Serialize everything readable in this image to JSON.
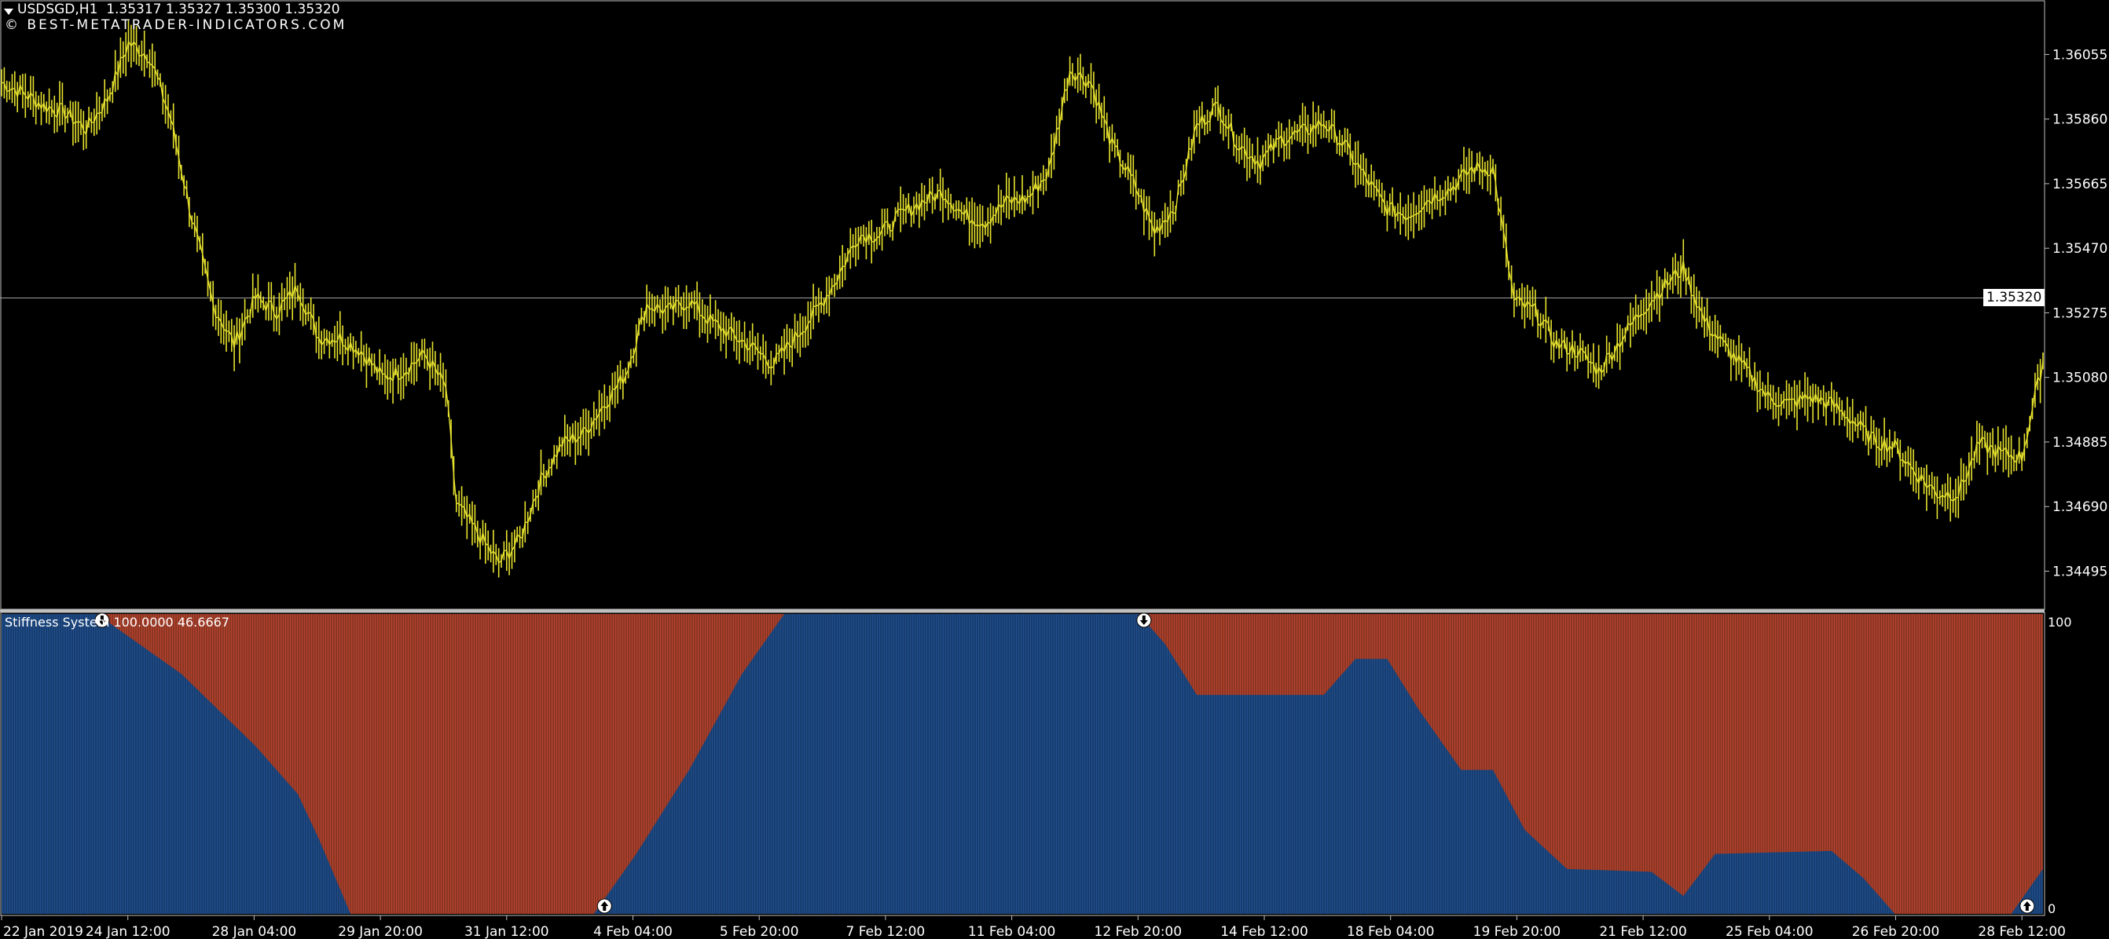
{
  "window": {
    "symbol_line": "USDSGD,H1  1.35317 1.35327 1.35300 1.35320",
    "watermark": "© BEST-METATRADER-INDICATORS.COM"
  },
  "colors": {
    "background": "#000000",
    "price_line": "#e6e22e",
    "grid_line": "#c0c0c0",
    "indicator_blue": "#1f4f8f",
    "indicator_red": "#b5452e",
    "text": "#ffffff"
  },
  "price_axis": {
    "labels": [
      "1.36055",
      "1.35860",
      "1.35665",
      "1.35470",
      "1.35275",
      "1.35080",
      "1.34885",
      "1.34690",
      "1.34495"
    ],
    "current_price": "1.35320"
  },
  "indicator": {
    "label": "Stiffness System 100.0000 46.6667",
    "axis_top": "100",
    "axis_bottom": "0"
  },
  "time_axis": {
    "labels": [
      "22 Jan 2019",
      "24 Jan 12:00",
      "28 Jan 04:00",
      "29 Jan 20:00",
      "31 Jan 12:00",
      "4 Feb 04:00",
      "5 Feb 20:00",
      "7 Feb 12:00",
      "11 Feb 04:00",
      "12 Feb 20:00",
      "14 Feb 12:00",
      "18 Feb 04:00",
      "19 Feb 20:00",
      "21 Feb 12:00",
      "25 Feb 04:00",
      "26 Feb 20:00",
      "28 Feb 12:00"
    ]
  },
  "chart_data": [
    {
      "type": "line",
      "title": "USDSGD,H1",
      "ylim": [
        1.3438,
        1.3621
      ],
      "x_labels": [
        "22 Jan 2019",
        "24 Jan 12:00",
        "28 Jan 04:00",
        "29 Jan 20:00",
        "31 Jan 12:00",
        "4 Feb 04:00",
        "5 Feb 20:00",
        "7 Feb 12:00",
        "11 Feb 04:00",
        "12 Feb 20:00",
        "14 Feb 12:00",
        "18 Feb 04:00",
        "19 Feb 20:00",
        "21 Feb 12:00",
        "25 Feb 04:00",
        "26 Feb 20:00",
        "28 Feb 12:00"
      ],
      "series": [
        {
          "name": "USDSGD",
          "values": [
            [
              0,
              1.3597
            ],
            [
              4,
              1.3594
            ],
            [
              8,
              1.359
            ],
            [
              12,
              1.3588
            ],
            [
              16,
              1.3583
            ],
            [
              20,
              1.3592
            ],
            [
              24,
              1.3609
            ],
            [
              28,
              1.3605
            ],
            [
              32,
              1.3586
            ],
            [
              36,
              1.3556
            ],
            [
              40,
              1.353
            ],
            [
              44,
              1.3518
            ],
            [
              48,
              1.3532
            ],
            [
              52,
              1.3528
            ],
            [
              56,
              1.3535
            ],
            [
              60,
              1.352
            ],
            [
              64,
              1.352
            ],
            [
              68,
              1.3516
            ],
            [
              72,
              1.3508
            ],
            [
              76,
              1.351
            ],
            [
              80,
              1.3515
            ],
            [
              84,
              1.3505
            ],
            [
              86,
              1.347
            ],
            [
              90,
              1.3461
            ],
            [
              94,
              1.3452
            ],
            [
              98,
              1.3459
            ],
            [
              102,
              1.3477
            ],
            [
              106,
              1.3488
            ],
            [
              110,
              1.3491
            ],
            [
              114,
              1.35
            ],
            [
              118,
              1.3509
            ],
            [
              122,
              1.353
            ],
            [
              126,
              1.3528
            ],
            [
              130,
              1.3531
            ],
            [
              134,
              1.3525
            ],
            [
              138,
              1.3521
            ],
            [
              142,
              1.3517
            ],
            [
              146,
              1.3512
            ],
            [
              150,
              1.352
            ],
            [
              154,
              1.3528
            ],
            [
              158,
              1.3538
            ],
            [
              162,
              1.3551
            ],
            [
              166,
              1.3551
            ],
            [
              170,
              1.3557
            ],
            [
              174,
              1.3561
            ],
            [
              178,
              1.3564
            ],
            [
              182,
              1.3557
            ],
            [
              186,
              1.3555
            ],
            [
              190,
              1.3561
            ],
            [
              194,
              1.3562
            ],
            [
              198,
              1.357
            ],
            [
              202,
              1.3601
            ],
            [
              206,
              1.3597
            ],
            [
              210,
              1.3578
            ],
            [
              214,
              1.3567
            ],
            [
              218,
              1.3552
            ],
            [
              222,
              1.356
            ],
            [
              226,
              1.3584
            ],
            [
              230,
              1.359
            ],
            [
              234,
              1.3578
            ],
            [
              238,
              1.3573
            ],
            [
              242,
              1.358
            ],
            [
              246,
              1.3582
            ],
            [
              250,
              1.3585
            ],
            [
              254,
              1.3578
            ],
            [
              258,
              1.3568
            ],
            [
              262,
              1.3559
            ],
            [
              266,
              1.3557
            ],
            [
              270,
              1.3562
            ],
            [
              274,
              1.3565
            ],
            [
              278,
              1.3571
            ],
            [
              282,
              1.3571
            ],
            [
              286,
              1.3531
            ],
            [
              290,
              1.3528
            ],
            [
              294,
              1.3518
            ],
            [
              298,
              1.3516
            ],
            [
              302,
              1.351
            ],
            [
              306,
              1.3519
            ],
            [
              310,
              1.3528
            ],
            [
              314,
              1.3535
            ],
            [
              318,
              1.3541
            ],
            [
              322,
              1.3525
            ],
            [
              326,
              1.3517
            ],
            [
              330,
              1.351
            ],
            [
              334,
              1.3502
            ],
            [
              338,
              1.35
            ],
            [
              342,
              1.3502
            ],
            [
              346,
              1.35
            ],
            [
              350,
              1.3495
            ],
            [
              354,
              1.3489
            ],
            [
              358,
              1.3487
            ],
            [
              362,
              1.3479
            ],
            [
              366,
              1.3473
            ],
            [
              370,
              1.3473
            ],
            [
              374,
              1.3488
            ],
            [
              378,
              1.3485
            ],
            [
              382,
              1.3484
            ],
            [
              386,
              1.3513
            ]
          ]
        }
      ]
    },
    {
      "type": "area",
      "title": "Stiffness System",
      "ylim": [
        0,
        100
      ],
      "series": [
        {
          "name": "blue",
          "values": [
            [
              0,
              100
            ],
            [
              18,
              100
            ],
            [
              34,
              80
            ],
            [
              48,
              56
            ],
            [
              56,
              40
            ],
            [
              60,
              25
            ],
            [
              66,
              0
            ],
            [
              112,
              0
            ],
            [
              120,
              20
            ],
            [
              130,
              48
            ],
            [
              140,
              80
            ],
            [
              148,
              100
            ],
            [
              215,
              100
            ],
            [
              220,
              90
            ],
            [
              226,
              73
            ],
            [
              236,
              73
            ],
            [
              250,
              73
            ],
            [
              256,
              85
            ],
            [
              262,
              85
            ],
            [
              268,
              68
            ],
            [
              276,
              48
            ],
            [
              282,
              48
            ],
            [
              288,
              28
            ],
            [
              296,
              15
            ],
            [
              312,
              14
            ],
            [
              318,
              6
            ],
            [
              324,
              20
            ],
            [
              346,
              21
            ],
            [
              352,
              12
            ],
            [
              358,
              0
            ],
            [
              380,
              0
            ],
            [
              386,
              15
            ]
          ]
        }
      ],
      "annotations": [
        {
          "kind": "down-arrow",
          "x": 19,
          "y": 100
        },
        {
          "kind": "up-arrow",
          "x": 114,
          "y": 0
        },
        {
          "kind": "down-arrow",
          "x": 216,
          "y": 100
        },
        {
          "kind": "up-arrow",
          "x": 383,
          "y": 0
        }
      ]
    }
  ]
}
